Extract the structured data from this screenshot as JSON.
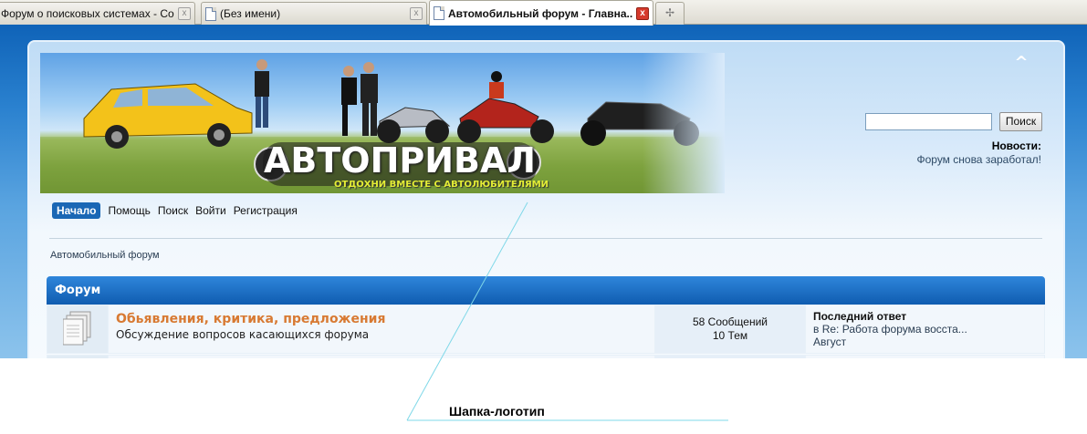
{
  "browser": {
    "tabs": [
      {
        "title": "Форум о поисковых системах - Созда..."
      },
      {
        "title": "(Без имени)"
      },
      {
        "title": "Автомобильный форум - Главна...",
        "active": true
      }
    ],
    "new_tab_icon": "plus-icon",
    "close_icon": "x"
  },
  "header": {
    "logo_text": "АВТОПРИВАЛ",
    "slogan": "ОТДОХНИ ВМЕСТЕ С АВТОЛЮБИТЕЛЯМИ",
    "scroll_up_icon": "^"
  },
  "search": {
    "value": "",
    "button_label": "Поиск"
  },
  "news": {
    "title": "Новости:",
    "text": "Форум снова заработал!"
  },
  "menu": {
    "items": [
      {
        "label": "Начало",
        "active": true
      },
      {
        "label": "Помощь"
      },
      {
        "label": "Поиск"
      },
      {
        "label": "Войти"
      },
      {
        "label": "Регистрация"
      }
    ]
  },
  "breadcrumb": {
    "text": "Автомобильный форум"
  },
  "forum": {
    "section_title": "Форум",
    "boards": [
      {
        "name": "Обьявления, критика, предложения",
        "description": "Обсуждение вопросов касающихся форума",
        "posts": "58 Сообщений",
        "topics": "10 Тем",
        "last_title": "Последний ответ",
        "last_topic": "в Re: Работа форума восста...",
        "last_date": "Август"
      }
    ]
  },
  "annotation": {
    "label": "Шапка-логотип"
  },
  "colors": {
    "accent": "#1a67b5",
    "board_link": "#d87a33",
    "page_background_top": "#0f63b8"
  }
}
